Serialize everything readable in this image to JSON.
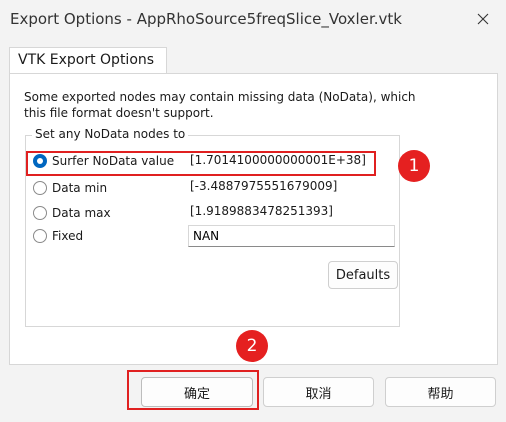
{
  "window": {
    "title": "Export Options - AppRhoSource5freqSlice_Voxler.vtk",
    "close_glyph": "✕"
  },
  "tab": {
    "label": "VTK Export Options"
  },
  "message": "Some exported nodes may contain missing data (NoData), which this file format doesn't support.",
  "group": {
    "title": "Set any NoData nodes to",
    "options": [
      {
        "label": "Surfer NoData value",
        "value": "[1.7014100000000001E+38]",
        "selected": true
      },
      {
        "label": "Data min",
        "value": "[-3.4887975551679009]",
        "selected": false
      },
      {
        "label": "Data max",
        "value": "[1.9189883478251393]",
        "selected": false
      },
      {
        "label": "Fixed",
        "value": "NAN",
        "selected": false
      }
    ]
  },
  "defaults_label": "Defaults",
  "buttons": {
    "ok": "确定",
    "cancel": "取消",
    "help": "帮助"
  },
  "annotations": {
    "badge1": "1",
    "badge2": "2",
    "color": "#e02020"
  }
}
